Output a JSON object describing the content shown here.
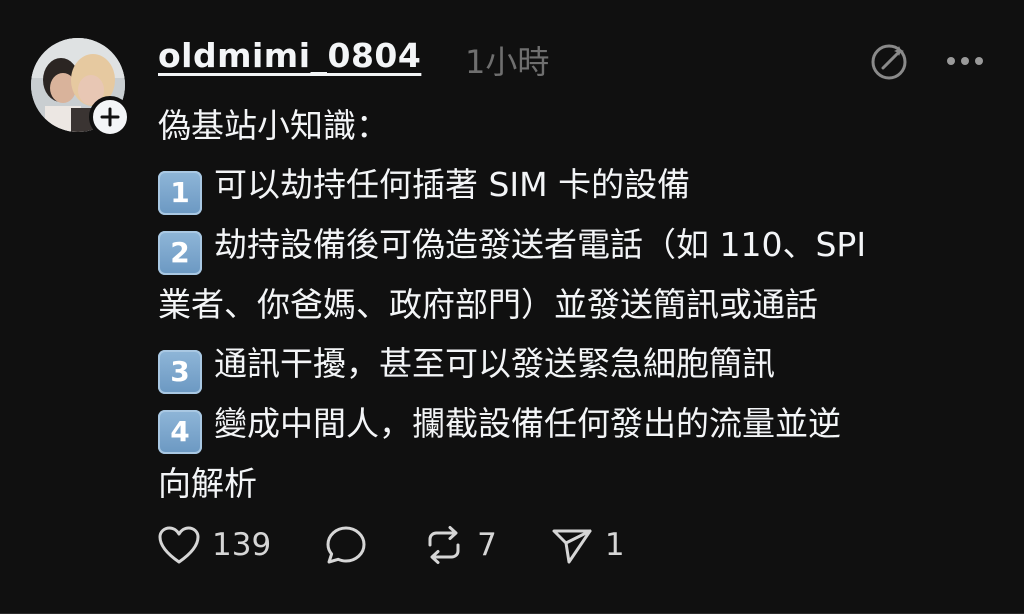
{
  "post": {
    "username": "oldmimi_0804",
    "timestamp": "1小時",
    "header_icons": [
      "ai-edit-icon",
      "more-options-icon"
    ],
    "avatar_icon": "profile-photo",
    "follow_icon": "plus-icon"
  },
  "content": {
    "intro": "偽基站小知識：",
    "items": [
      {
        "key": "1",
        "lines": [
          "可以劫持任何插著 SIM 卡的設備"
        ]
      },
      {
        "key": "2",
        "lines": [
          "劫持設備後可偽造發送者電話（如 110、SPI",
          "業者、你爸媽、政府部門）並發送簡訊或通話"
        ]
      },
      {
        "key": "3",
        "lines": [
          "通訊干擾，甚至可以發送緊急細胞簡訊"
        ]
      },
      {
        "key": "4",
        "lines": [
          "變成中間人，攔截設備任何發出的流量並逆",
          "向解析"
        ]
      }
    ]
  },
  "actions": {
    "like": {
      "icon": "heart-icon",
      "count": "139"
    },
    "reply": {
      "icon": "comment-icon",
      "count": ""
    },
    "repost": {
      "icon": "repost-icon",
      "count": "7"
    },
    "share": {
      "icon": "send-icon",
      "count": "1"
    }
  },
  "colors": {
    "background": "#101010",
    "text": "#f3f5f7",
    "muted": "#6f6f6f",
    "keycap": "#7ea7cf"
  }
}
